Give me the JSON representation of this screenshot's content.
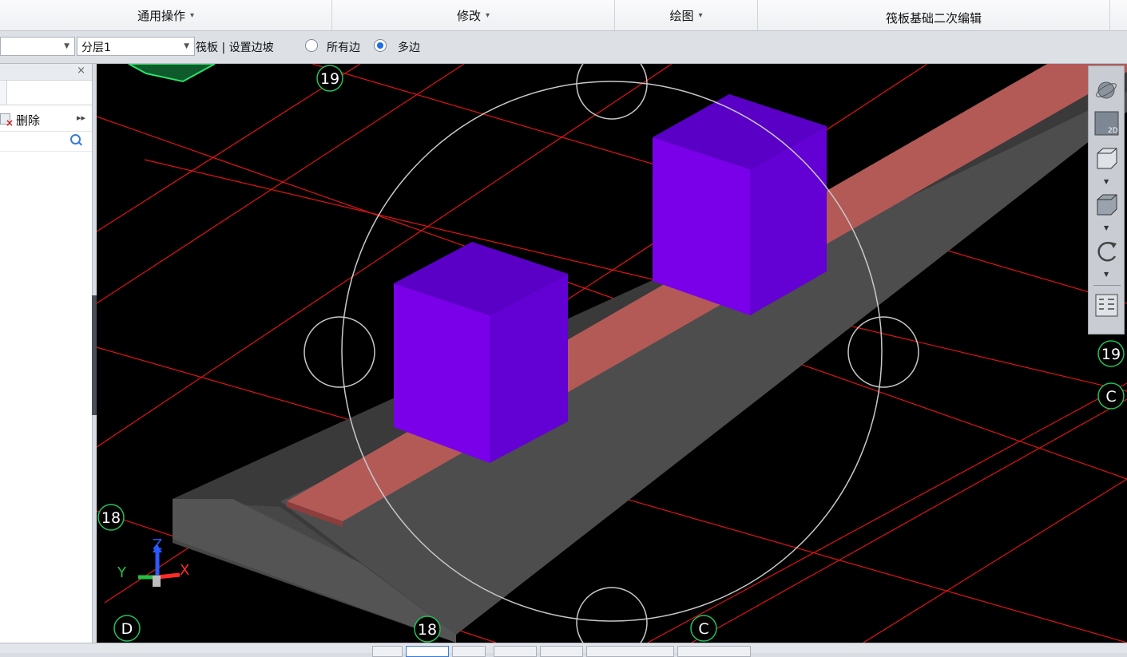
{
  "menubar": {
    "items": [
      {
        "label": "通用操作",
        "caret": "▾"
      },
      {
        "label": "修改",
        "caret": "▾"
      },
      {
        "label": "绘图",
        "caret": "▾"
      },
      {
        "label": "筏板基础二次编辑",
        "caret": ""
      }
    ]
  },
  "toolbar": {
    "combo_left_value": "",
    "layer_value": "分层1",
    "context_label": "筏板 | 设置边坡",
    "radio_all_edges": "所有边",
    "radio_multi_edges": "多边",
    "selected": "多边"
  },
  "panel": {
    "close": "×",
    "delete_label": "删除",
    "more": "▸▸",
    "search_placeholder": ""
  },
  "viewport": {
    "grid_labels": [
      "19",
      "19",
      "18",
      "18",
      "D",
      "C",
      "C"
    ],
    "axis_labels": {
      "x": "X",
      "y": "Y",
      "z": "Z"
    },
    "colors": {
      "background": "#000000",
      "grid": "#e01414",
      "slab": "#4b4b4b",
      "strip": "#b35a57",
      "column": "#6a00d8",
      "label": "#22c05a",
      "orbit": "#c8c8c8"
    }
  },
  "view_tools": {
    "items": [
      "orbit-icon",
      "2d-view-icon",
      "wireframe-cube-icon",
      "solid-cube-icon",
      "rotate-icon",
      "display-settings-icon"
    ],
    "mode_2d": "2D"
  }
}
